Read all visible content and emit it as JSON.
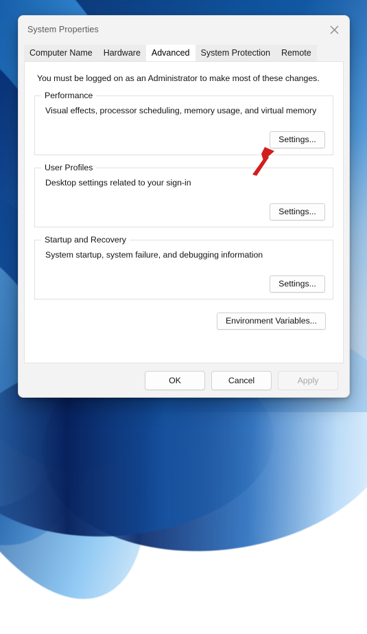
{
  "window": {
    "title": "System Properties",
    "close_icon": "close-icon"
  },
  "tabs": [
    {
      "label": "Computer Name",
      "selected": false
    },
    {
      "label": "Hardware",
      "selected": false
    },
    {
      "label": "Advanced",
      "selected": true
    },
    {
      "label": "System Protection",
      "selected": false
    },
    {
      "label": "Remote",
      "selected": false
    }
  ],
  "content": {
    "admin_note": "You must be logged on as an Administrator to make most of these changes.",
    "groups": [
      {
        "title": "Performance",
        "description": "Visual effects, processor scheduling, memory usage, and virtual memory",
        "button_label": "Settings..."
      },
      {
        "title": "User Profiles",
        "description": "Desktop settings related to your sign-in",
        "button_label": "Settings..."
      },
      {
        "title": "Startup and Recovery",
        "description": "System startup, system failure, and debugging information",
        "button_label": "Settings..."
      }
    ],
    "environment_variables_label": "Environment Variables..."
  },
  "footer": {
    "ok_label": "OK",
    "cancel_label": "Cancel",
    "apply_label": "Apply",
    "apply_disabled": true
  },
  "annotation": {
    "arrow_color": "#d01f1f",
    "points_to": "Settings..."
  },
  "colors": {
    "dialog_bg": "#f3f3f3",
    "panel_bg": "#ffffff",
    "title_text": "#5b5b5b",
    "body_text": "#111111",
    "disabled_text": "#a6a6a6",
    "group_border": "#e0e0e0",
    "desktop_blue": "#10549f"
  }
}
